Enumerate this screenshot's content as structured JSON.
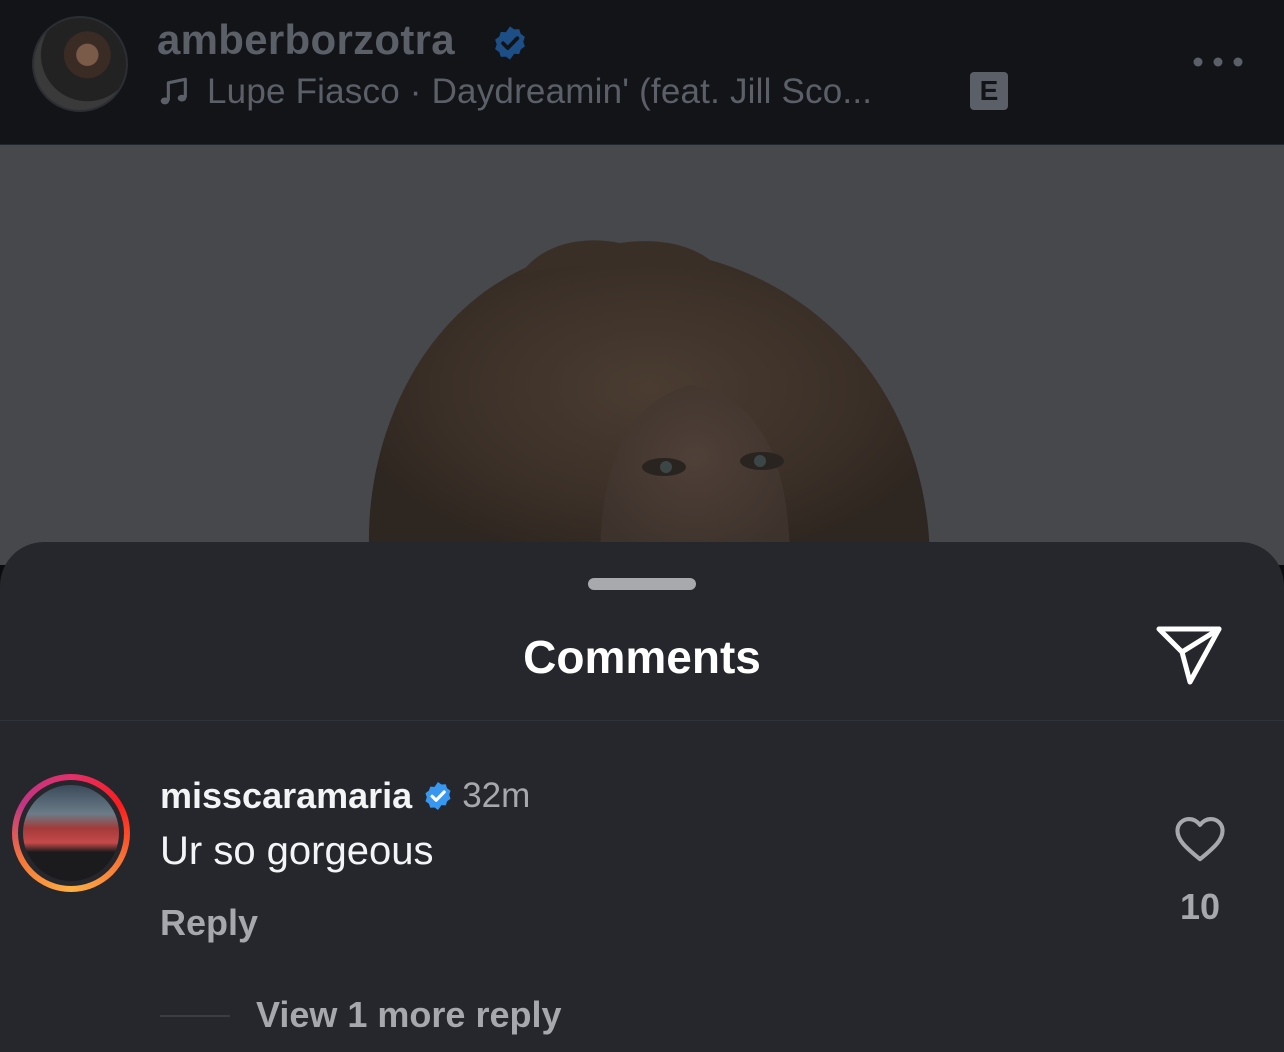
{
  "post": {
    "username": "amberborzotra",
    "song": "Lupe Fiasco · Daydreamin' (feat. Jill Sco...",
    "explicit_label": "E"
  },
  "comments_sheet": {
    "title": "Comments",
    "comment": {
      "username": "misscaramaria",
      "time": "32m",
      "text": "Ur so gorgeous",
      "reply_label": "Reply",
      "like_count": "10",
      "view_replies_label": "View 1 more reply"
    }
  },
  "colors": {
    "sheet_background": "#25272c",
    "verified_blue": "#3897f0",
    "muted_text": "#a6a8ad"
  },
  "icons": {
    "music": "music-note-icon",
    "verified": "verified-badge-icon",
    "more": "more-options-icon",
    "share": "share-paper-plane-icon",
    "like": "heart-icon"
  }
}
